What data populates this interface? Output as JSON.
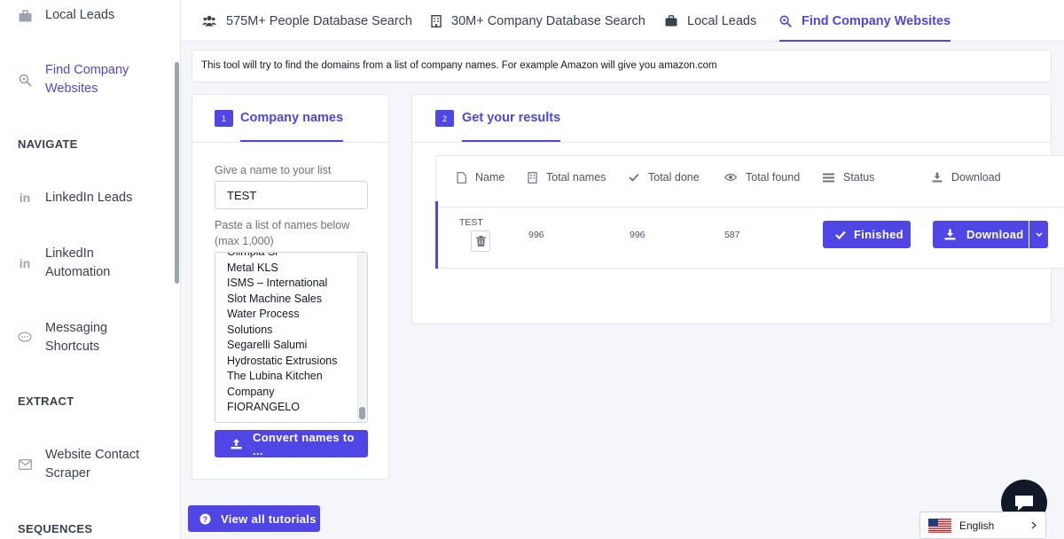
{
  "sidebar": {
    "items": [
      {
        "label": "Local Leads",
        "icon": "briefcase-icon"
      },
      {
        "label": "Find Company Websites",
        "icon": "search-icon",
        "active": true
      },
      {
        "label": "LinkedIn Leads",
        "icon": "linkedin-icon"
      },
      {
        "label": "LinkedIn Automation",
        "icon": "linkedin-icon"
      },
      {
        "label": "Messaging Shortcuts",
        "icon": "chat-icon"
      },
      {
        "label": "Website Contact Scraper",
        "icon": "envelope-icon"
      }
    ],
    "headings": {
      "navigate": "NAVIGATE",
      "extract": "EXTRACT",
      "sequences": "SEQUENCES"
    }
  },
  "tabs": [
    {
      "label": "575M+ People Database Search",
      "icon": "users-icon"
    },
    {
      "label": "30M+ Company Database Search",
      "icon": "building-icon"
    },
    {
      "label": "Local Leads",
      "icon": "briefcase-icon"
    },
    {
      "label": "Find Company Websites",
      "icon": "search-icon",
      "active": true
    }
  ],
  "info_text": "This tool will try to find the domains from a list of company names. For example Amazon will give you amazon.com",
  "step1": {
    "number": "1",
    "title": "Company names",
    "name_label": "Give a name to your list",
    "name_value": "TEST",
    "paste_label": "Paste a list of names below (max 1,000)",
    "names": [
      "Olimpia Sr",
      "Metal KLS",
      "ISMS – International",
      "Slot Machine Sales",
      "Water Process",
      "Solutions",
      "Segarelli Salumi",
      "Hydrostatic Extrusions",
      "The Lubina Kitchen",
      "Company",
      "FIORANGELO"
    ],
    "convert_label": "Convert names to ..."
  },
  "step2": {
    "number": "2",
    "title": "Get your results",
    "headers": {
      "name": "Name",
      "total_names": "Total names",
      "total_done": "Total done",
      "total_found": "Total found",
      "status": "Status",
      "download": "Download"
    },
    "row": {
      "name": "TEST",
      "total_names": "996",
      "total_done": "996",
      "total_found": "587",
      "status": "Finished",
      "download": "Download"
    }
  },
  "tutorials_label": "View all tutorials",
  "language": "English",
  "colors": {
    "accent": "#4f46e5",
    "border": "#e5e7eb",
    "background": "#f5f6fa"
  }
}
